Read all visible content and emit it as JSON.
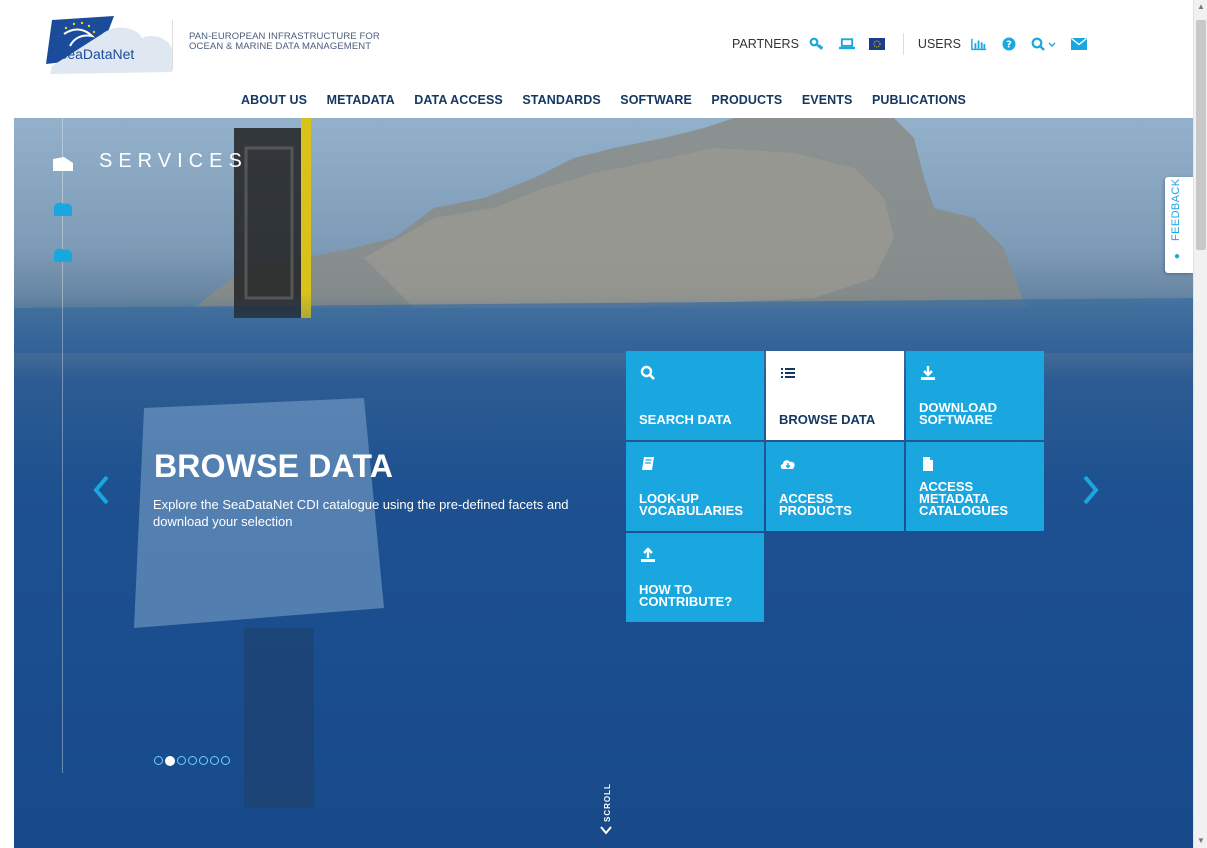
{
  "header": {
    "logo_text": "SeaDataNet",
    "tagline_line1": "PAN-EUROPEAN INFRASTRUCTURE FOR",
    "tagline_line2": "OCEAN & MARINE DATA MANAGEMENT",
    "partners_label": "PARTNERS",
    "users_label": "USERS",
    "partner_icons": [
      "key-icon",
      "laptop-icon",
      "eu-flag-icon"
    ],
    "user_icons": [
      "bar-chart-icon",
      "help-icon",
      "search-icon",
      "envelope-icon"
    ]
  },
  "nav": {
    "items": [
      "ABOUT US",
      "METADATA",
      "DATA ACCESS",
      "STANDARDS",
      "SOFTWARE",
      "PRODUCTS",
      "EVENTS",
      "PUBLICATIONS"
    ]
  },
  "hero": {
    "section_title": "SERVICES",
    "slide_title": "BROWSE DATA",
    "slide_description": "Explore the SeaDataNet CDI catalogue using the pre-defined facets and download your selection",
    "active_dot_index": 1,
    "dot_count": 7,
    "scroll_label": "SCROLL",
    "feedback_label": "FEEDBACK"
  },
  "tiles": [
    {
      "label_line1": "SEARCH DATA",
      "label_line2": "",
      "label_line3": "",
      "icon": "search-icon",
      "active": false
    },
    {
      "label_line1": "BROWSE DATA",
      "label_line2": "",
      "label_line3": "",
      "icon": "list-icon",
      "active": true
    },
    {
      "label_line1": "DOWNLOAD",
      "label_line2": "SOFTWARE",
      "label_line3": "",
      "icon": "download-icon",
      "active": false
    },
    {
      "label_line1": "LOOK-UP",
      "label_line2": "VOCABULARIES",
      "label_line3": "",
      "icon": "book-icon",
      "active": false
    },
    {
      "label_line1": "ACCESS",
      "label_line2": "PRODUCTS",
      "label_line3": "",
      "icon": "cloud-download-icon",
      "active": false
    },
    {
      "label_line1": "ACCESS",
      "label_line2": "METADATA",
      "label_line3": "CATALOGUES",
      "icon": "document-icon",
      "active": false
    },
    {
      "label_line1": "HOW TO",
      "label_line2": "CONTRIBUTE?",
      "label_line3": "",
      "icon": "upload-icon",
      "active": false
    }
  ],
  "colors": {
    "accent": "#1aa7e0",
    "nav_text": "#153862",
    "hero_deep": "#1b4e8f"
  }
}
